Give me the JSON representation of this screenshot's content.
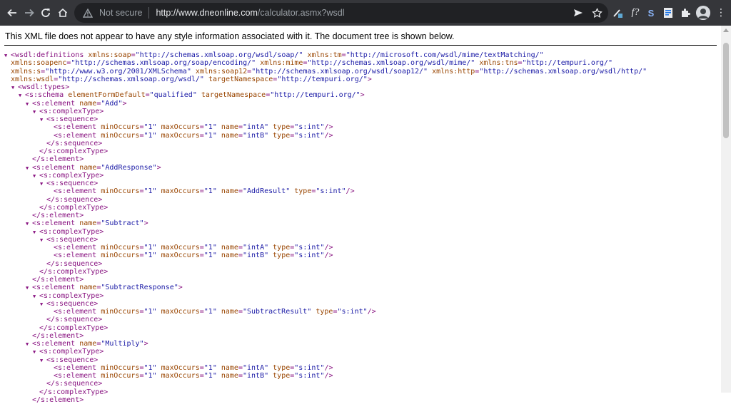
{
  "browser": {
    "not_secure_label": "Not secure",
    "url_host": "http://www.dneonline.com",
    "url_path": "/calculator.asmx?wsdl",
    "icons": [
      "back-icon",
      "forward-icon",
      "reload-icon",
      "home-icon",
      "warning-icon",
      "send-icon",
      "bookmark-star-icon",
      "pen-extension-icon",
      "formula-extension-icon",
      "s-extension-icon",
      "doc-extension-icon",
      "puzzle-icon",
      "avatar"
    ],
    "extension_f_label": "f?",
    "extension_s_label": "S"
  },
  "viewer": {
    "info_text": "This XML file does not appear to have any style information associated with it. The document tree is shown below."
  },
  "xml": {
    "root_open_tag": "<wsdl:definitions",
    "root_attrs_line1": [
      {
        "n": "xmlns:soap",
        "v": "\"http://schemas.xmlsoap.org/wsdl/soap/\""
      },
      {
        "n": "xmlns:tm",
        "v": "\"http://microsoft.com/wsdl/mime/textMatching/\""
      }
    ],
    "root_attrs_line2": [
      {
        "n": "xmlns:soapenc",
        "v": "\"http://schemas.xmlsoap.org/soap/encoding/\""
      },
      {
        "n": "xmlns:mime",
        "v": "\"http://schemas.xmlsoap.org/wsdl/mime/\""
      },
      {
        "n": "xmlns:tns",
        "v": "\"http://tempuri.org/\""
      }
    ],
    "root_attrs_line3": [
      {
        "n": "xmlns:s",
        "v": "\"http://www.w3.org/2001/XMLSchema\""
      },
      {
        "n": "xmlns:soap12",
        "v": "\"http://schemas.xmlsoap.org/wsdl/soap12/\""
      },
      {
        "n": "xmlns:http",
        "v": "\"http://schemas.xmlsoap.org/wsdl/http/\""
      }
    ],
    "root_attrs_line4": [
      {
        "n": "xmlns:wsdl",
        "v": "\"http://schemas.xmlsoap.org/wsdl/\""
      },
      {
        "n": "targetNamespace",
        "v": "\"http://tempuri.org/\""
      }
    ],
    "types_tag": "<wsdl:types>",
    "schema_tag": "<s:schema",
    "schema_attrs": [
      {
        "n": "elementFormDefault",
        "v": "\"qualified\""
      },
      {
        "n": "targetNamespace",
        "v": "\"http://tempuri.org/\""
      }
    ],
    "element_tag": "<s:element",
    "element_close": "</s:element>",
    "complex_open": "<s:complexType>",
    "complex_close": "</s:complexType>",
    "sequence_open": "<s:sequence>",
    "sequence_close": "</s:sequence>",
    "attr_name": "name",
    "attr_min": "minOccurs",
    "attr_max": "maxOccurs",
    "attr_type": "type",
    "val_one": "\"1\"",
    "val_int": "\"s:int\"",
    "elements": [
      {
        "name": "\"Add\"",
        "fields": [
          "\"intA\"",
          "\"intB\""
        ]
      },
      {
        "name": "\"AddResponse\"",
        "fields": [
          "\"AddResult\""
        ]
      },
      {
        "name": "\"Subtract\"",
        "fields": [
          "\"intA\"",
          "\"intB\""
        ]
      },
      {
        "name": "\"SubtractResponse\"",
        "fields": [
          "\"SubtractResult\""
        ]
      },
      {
        "name": "\"Multiply\"",
        "fields": [
          "\"intA\"",
          "\"intB\""
        ]
      }
    ]
  }
}
